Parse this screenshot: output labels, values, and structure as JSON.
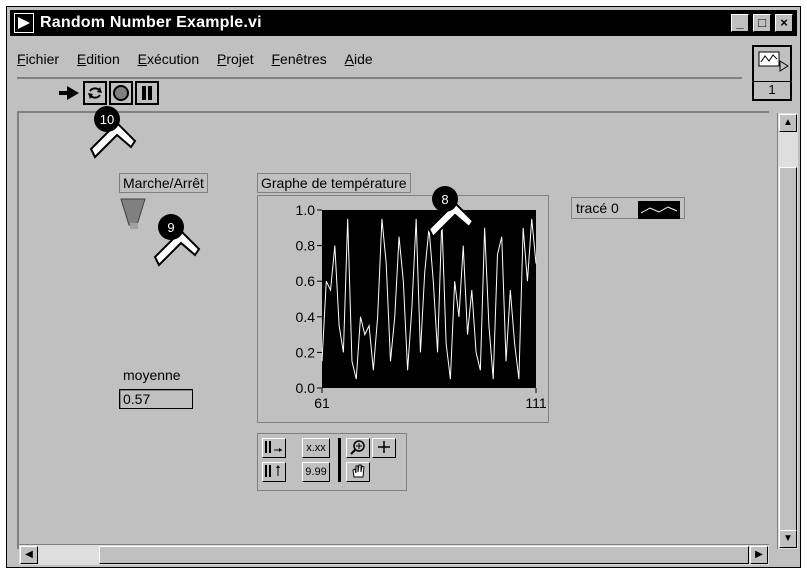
{
  "window": {
    "title": "Random Number Example.vi",
    "controls": {
      "minimize": "_",
      "maximize": "□",
      "close": "×"
    }
  },
  "menu": {
    "items": [
      {
        "mnemonic": "F",
        "rest": "ichier"
      },
      {
        "mnemonic": "E",
        "rest": "dition"
      },
      {
        "mnemonic": "E",
        "rest": "xécution"
      },
      {
        "mnemonic": "P",
        "rest": "rojet"
      },
      {
        "mnemonic": "F",
        "rest": "enêtres"
      },
      {
        "mnemonic": "A",
        "rest": "ide"
      }
    ]
  },
  "toolbar": {
    "buttons": [
      "run-arrow-icon",
      "run-continuously-icon",
      "abort-icon",
      "pause-icon"
    ]
  },
  "vi_icon": {
    "label": "1"
  },
  "front_panel": {
    "switch_label": "Marche/Arrêt",
    "graph_label": "Graphe de température",
    "legend_label": "tracé 0",
    "average_label": "moyenne",
    "average_value": "0.57"
  },
  "callouts": [
    "10",
    "9",
    "8"
  ],
  "chart_data": {
    "type": "line",
    "xlim": [
      61,
      111
    ],
    "ylim": [
      0,
      1
    ],
    "x_ticks": [
      "61",
      "111"
    ],
    "y_ticks": [
      "1.0",
      "0.8",
      "0.6",
      "0.4",
      "0.2",
      "0.0"
    ],
    "background": "#000000",
    "line_color": "#ffffff",
    "series": [
      {
        "name": "tracé 0",
        "values": [
          0.15,
          0.6,
          0.55,
          0.8,
          0.35,
          0.2,
          0.95,
          0.15,
          0.05,
          0.4,
          0.3,
          0.35,
          0.1,
          0.4,
          0.95,
          0.7,
          0.15,
          0.4,
          0.85,
          0.6,
          0.1,
          0.45,
          0.95,
          0.2,
          0.65,
          0.9,
          0.6,
          0.2,
          0.95,
          0.25,
          0.05,
          0.6,
          0.4,
          0.8,
          0.3,
          0.55,
          0.2,
          0.1,
          0.9,
          0.35,
          0.05,
          0.75,
          0.85,
          0.15,
          0.55,
          0.25,
          0.05,
          0.9,
          0.6,
          0.95,
          0.7
        ]
      }
    ]
  },
  "colors": {
    "window_bg": "#c0c0c0",
    "title_bg": "#000000",
    "chart_bg": "#000000"
  }
}
